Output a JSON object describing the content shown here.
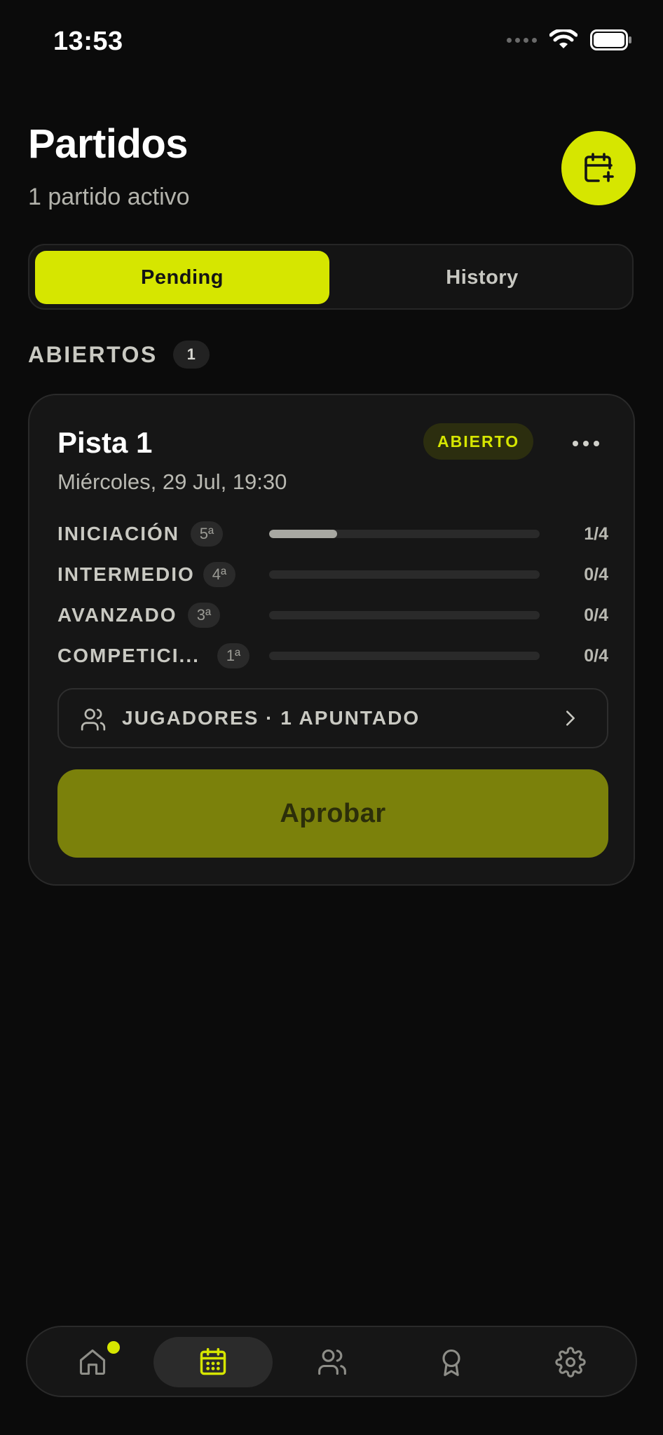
{
  "status_bar": {
    "time": "13:53"
  },
  "header": {
    "title": "Partidos",
    "subtitle": "1 partido activo",
    "add_button_icon": "calendar-plus-icon"
  },
  "segments": {
    "pending_label": "Pending",
    "history_label": "History",
    "selected": "Pending"
  },
  "section": {
    "title": "ABIERTOS",
    "count": "1"
  },
  "match": {
    "title": "Pista 1",
    "status": "ABIERTO",
    "date": "Miércoles, 29 Jul, 19:30",
    "levels": [
      {
        "name": "INICIACIÓN",
        "rank": "5ª",
        "count": "1/4",
        "filled": 1,
        "capacity": 4
      },
      {
        "name": "INTERMEDIO",
        "rank": "4ª",
        "count": "0/4",
        "filled": 0,
        "capacity": 4
      },
      {
        "name": "AVANZADO",
        "rank": "3ª",
        "count": "0/4",
        "filled": 0,
        "capacity": 4
      },
      {
        "name": "COMPETICI...",
        "rank": "1ª",
        "count": "0/4",
        "filled": 0,
        "capacity": 4
      }
    ],
    "players_label": "JUGADORES · 1 APUNTADO",
    "approve_label": "Aprobar"
  },
  "tab_bar": {
    "items": [
      {
        "icon": "home-icon",
        "has_notification": true
      },
      {
        "icon": "calendar-icon",
        "active": true
      },
      {
        "icon": "users-icon"
      },
      {
        "icon": "award-icon"
      },
      {
        "icon": "settings-gear-icon"
      }
    ]
  },
  "colors": {
    "accent": "#d6e600",
    "background": "#0b0b0b",
    "card": "#161616",
    "approve_button": "#7b810b"
  }
}
